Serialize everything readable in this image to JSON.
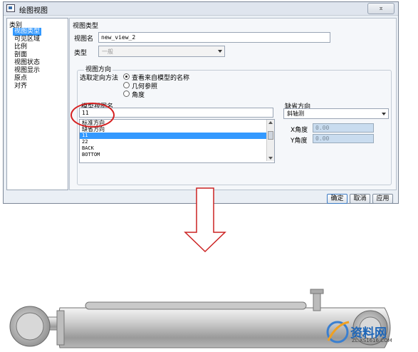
{
  "window": {
    "title": "绘图视图",
    "close_glyph": "⌅"
  },
  "category": {
    "header": "类别",
    "items": [
      "视图类型",
      "可见区域",
      "比例",
      "剖面",
      "视图状态",
      "视图显示",
      "原点",
      "对齐"
    ],
    "selected_index": 0
  },
  "view_type": {
    "section_title": "视图类型",
    "view_name_label": "视图名",
    "view_name_value": "new_view_2",
    "type_label": "类型",
    "type_value": "一般"
  },
  "view_orientation": {
    "group_title": "视图方向",
    "method_label": "选取定向方法",
    "options": [
      "查看来自模型的名称",
      "几何参照",
      "角度"
    ],
    "selected_option": 0,
    "model_view_name_label": "模型视图名",
    "model_view_name_value": "11",
    "list_items": [
      "标准方向",
      "缺省方向",
      "11",
      "22",
      "BACK",
      "BOTTOM"
    ],
    "selected_list_index": 2
  },
  "default_orientation": {
    "label": "缺省方向",
    "value": "斜轴测",
    "x_angle_label": "X角度",
    "x_angle_value": "0.00",
    "y_angle_label": "Y角度",
    "y_angle_value": "0.00"
  },
  "buttons": {
    "ok": "确定",
    "cancel": "取消",
    "apply": "应用"
  },
  "watermark": {
    "brand": "资料网",
    "url": "ZL.XS1616.COM"
  },
  "colors": {
    "selection": "#3399ff",
    "arrow_outline": "#cc2222",
    "annotation": "#d62020"
  }
}
